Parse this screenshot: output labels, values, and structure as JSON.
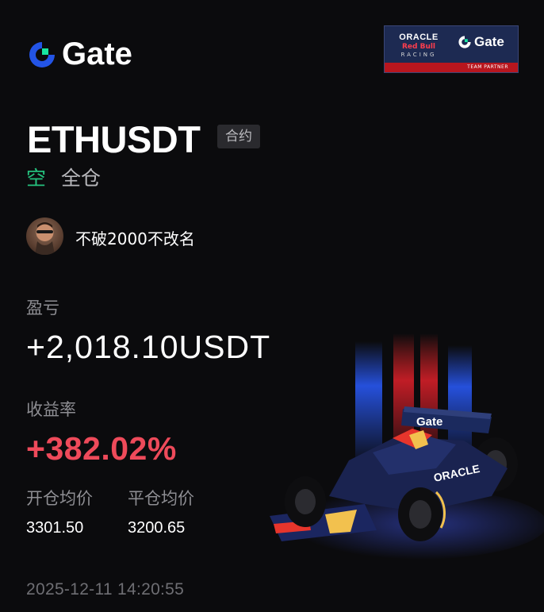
{
  "brand": {
    "name": "Gate",
    "accent_blue": "#2354e6",
    "accent_green": "#17e6a1"
  },
  "partner_badge": {
    "oracle": "ORACLE",
    "redbull": "Red Bull",
    "racing": "RACING",
    "gate": "Gate",
    "tagline": "TEAM PARTNER"
  },
  "position": {
    "symbol": "ETHUSDT",
    "type_tag": "合约",
    "side": "空",
    "margin_mode": "全仓"
  },
  "user": {
    "name": "不破2000不改名",
    "avatar_icon": "avatar-photo"
  },
  "pnl": {
    "label": "盈亏",
    "value": "+2,018.10USDT"
  },
  "roi": {
    "label": "收益率",
    "value": "+382.02%",
    "color": "#ee4a5a"
  },
  "prices": {
    "open_label": "开仓均价",
    "open_value": "3301.50",
    "close_label": "平仓均价",
    "close_value": "3200.65"
  },
  "timestamp": "2025-12-11 14:20:55",
  "illustration": {
    "livery_text": "Gate",
    "sponsor_text": "ORACLE"
  }
}
